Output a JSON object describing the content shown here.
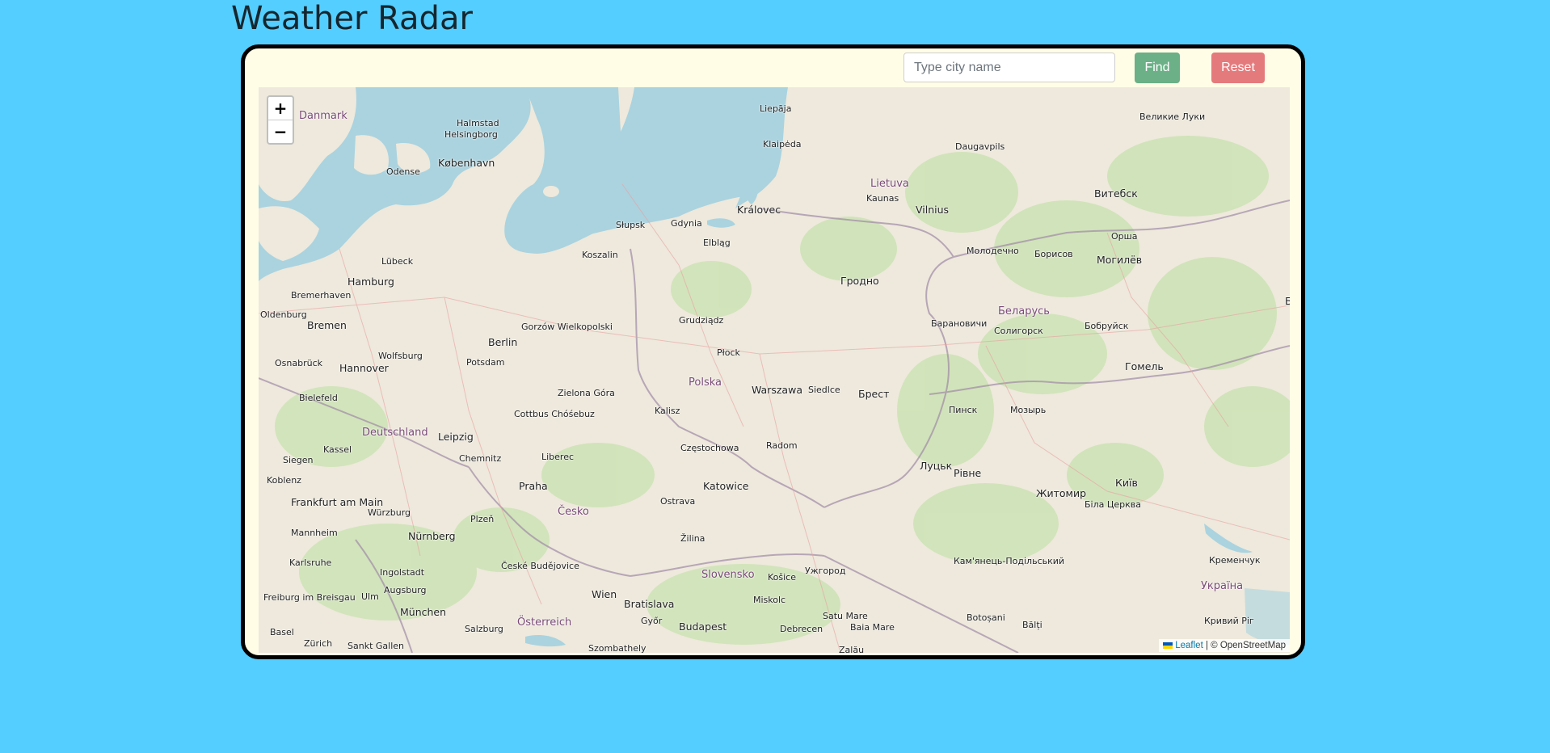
{
  "page": {
    "title": "Weather Radar"
  },
  "search": {
    "placeholder": "Type city name",
    "value": ""
  },
  "buttons": {
    "find_label": "Find",
    "reset_label": "Reset"
  },
  "colors": {
    "page_bg": "#54cefe",
    "card_bg": "#fffde6",
    "find": "#6bb087",
    "reset": "#e57a7c",
    "sea": "#aad3df",
    "land": "#eee9dc"
  },
  "map": {
    "zoom_in": "+",
    "zoom_out": "−",
    "attribution": {
      "leaflet": "Leaflet",
      "separator": " | © ",
      "osm": "OpenStreetMap"
    },
    "labels": [
      {
        "text": "Danmark",
        "kind": "country"
      },
      {
        "text": "Halmstad"
      },
      {
        "text": "Helsingborg"
      },
      {
        "text": "København",
        "kind": "big"
      },
      {
        "text": "Odense"
      },
      {
        "text": "Liepāja"
      },
      {
        "text": "Klaipėda"
      },
      {
        "text": "Daugavpils"
      },
      {
        "text": "Великие Луки"
      },
      {
        "text": "Lietuva",
        "kind": "country"
      },
      {
        "text": "Kaunas"
      },
      {
        "text": "Vilnius",
        "kind": "big"
      },
      {
        "text": "Витебск",
        "kind": "big"
      },
      {
        "text": "Královec",
        "kind": "big"
      },
      {
        "text": "Gdynia"
      },
      {
        "text": "Słupsk"
      },
      {
        "text": "Elbląg"
      },
      {
        "text": "Koszalin"
      },
      {
        "text": "Lübeck"
      },
      {
        "text": "Hamburg",
        "kind": "big"
      },
      {
        "text": "Bremerhaven"
      },
      {
        "text": "Oldenburg"
      },
      {
        "text": "Bremen",
        "kind": "big"
      },
      {
        "text": "Grudziądz"
      },
      {
        "text": "Гродно",
        "kind": "big"
      },
      {
        "text": "Молодечно"
      },
      {
        "text": "Борисов"
      },
      {
        "text": "Могилёв",
        "kind": "big"
      },
      {
        "text": "Орша"
      },
      {
        "text": "Брянск",
        "kind": "big"
      },
      {
        "text": "Беларусь",
        "kind": "country"
      },
      {
        "text": "Барановичи"
      },
      {
        "text": "Солигорск"
      },
      {
        "text": "Бобруйск"
      },
      {
        "text": "Gorzów Wielkopolski"
      },
      {
        "text": "Berlin",
        "kind": "big"
      },
      {
        "text": "Potsdam"
      },
      {
        "text": "Hannover",
        "kind": "big"
      },
      {
        "text": "Wolfsburg"
      },
      {
        "text": "Osnabrück"
      },
      {
        "text": "Płock"
      },
      {
        "text": "Polska",
        "kind": "country"
      },
      {
        "text": "Warszawa",
        "kind": "big"
      },
      {
        "text": "Siedlce"
      },
      {
        "text": "Брест",
        "kind": "big"
      },
      {
        "text": "Пинск"
      },
      {
        "text": "Мозырь"
      },
      {
        "text": "Гомель",
        "kind": "big"
      },
      {
        "text": "Bielefeld"
      },
      {
        "text": "Zielona Góra"
      },
      {
        "text": "Kalisz"
      },
      {
        "text": "Cottbus Chóśebuz"
      },
      {
        "text": "Leipzig",
        "kind": "big"
      },
      {
        "text": "Deutschland",
        "kind": "country"
      },
      {
        "text": "Kassel"
      },
      {
        "text": "Radom"
      },
      {
        "text": "Liberec"
      },
      {
        "text": "Chemnitz"
      },
      {
        "text": "Częstochowa"
      },
      {
        "text": "Siegen"
      },
      {
        "text": "Koblenz"
      },
      {
        "text": "Praha",
        "kind": "big"
      },
      {
        "text": "Katowice",
        "kind": "big"
      },
      {
        "text": "Луцьк",
        "kind": "big"
      },
      {
        "text": "Рівне",
        "kind": "big"
      },
      {
        "text": "Житомир",
        "kind": "big"
      },
      {
        "text": "Київ",
        "kind": "big"
      },
      {
        "text": "Біла Церква"
      },
      {
        "text": "Frankfurt am Main",
        "kind": "big"
      },
      {
        "text": "Würzburg"
      },
      {
        "text": "Ostrava"
      },
      {
        "text": "Česko",
        "kind": "country"
      },
      {
        "text": "Plzeň"
      },
      {
        "text": "Nürnberg",
        "kind": "big"
      },
      {
        "text": "Mannheim"
      },
      {
        "text": "Žilina"
      },
      {
        "text": "Karlsruhe"
      },
      {
        "text": "Ingolstadt"
      },
      {
        "text": "České Budějovice"
      },
      {
        "text": "Slovensko",
        "kind": "country"
      },
      {
        "text": "Košice"
      },
      {
        "text": "Ужгород"
      },
      {
        "text": "Кам'янець-Подільський"
      },
      {
        "text": "Кременчук"
      },
      {
        "text": "Augsburg"
      },
      {
        "text": "Freiburg im Breisgau"
      },
      {
        "text": "Ulm"
      },
      {
        "text": "Wien",
        "kind": "big"
      },
      {
        "text": "Bratislava",
        "kind": "big"
      },
      {
        "text": "Miskolc"
      },
      {
        "text": "München",
        "kind": "big"
      },
      {
        "text": "Győr"
      },
      {
        "text": "Satu Mare"
      },
      {
        "text": "Baia Mare"
      },
      {
        "text": "Botoșani"
      },
      {
        "text": "Bălți"
      },
      {
        "text": "Україна",
        "kind": "country"
      },
      {
        "text": "Кривий Ріг"
      },
      {
        "text": "Basel"
      },
      {
        "text": "Zürich"
      },
      {
        "text": "Salzburg"
      },
      {
        "text": "Österreich",
        "kind": "country"
      },
      {
        "text": "Budapest",
        "kind": "big"
      },
      {
        "text": "Debrecen"
      },
      {
        "text": "Sankt Gallen"
      },
      {
        "text": "Szombathely"
      },
      {
        "text": "Zalău"
      }
    ]
  }
}
